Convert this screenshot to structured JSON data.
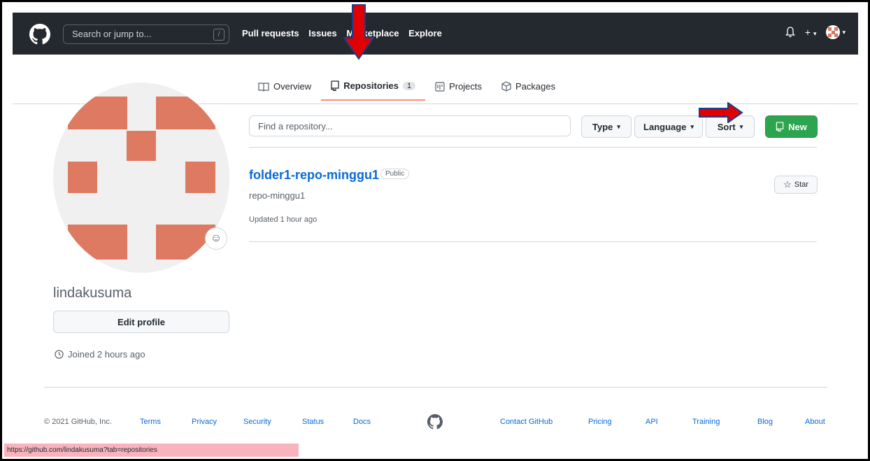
{
  "header": {
    "search_placeholder": "Search or jump to...",
    "search_shortcut": "/",
    "nav": [
      "Pull requests",
      "Issues",
      "Marketplace",
      "Explore"
    ],
    "icons": [
      "bell-icon",
      "plus-icon",
      "avatar"
    ]
  },
  "tabs": [
    {
      "label": "Overview",
      "icon": "book-icon"
    },
    {
      "label": "Repositories",
      "icon": "repo-icon",
      "count": "1",
      "active": true
    },
    {
      "label": "Projects",
      "icon": "project-icon"
    },
    {
      "label": "Packages",
      "icon": "package-icon"
    }
  ],
  "profile": {
    "username": "lindakusuma",
    "edit_label": "Edit profile",
    "joined": "Joined 2 hours ago"
  },
  "filters": {
    "find_placeholder": "Find a repository...",
    "type_label": "Type",
    "language_label": "Language",
    "sort_label": "Sort",
    "new_label": "New"
  },
  "repo": {
    "name": "folder1-repo-minggu1",
    "visibility": "Public",
    "description": "repo-minggu1",
    "updated": "Updated 1 hour ago",
    "star_label": "Star"
  },
  "footer": {
    "copyright": "© 2021 GitHub, Inc.",
    "links": [
      "Terms",
      "Privacy",
      "Security",
      "Status",
      "Docs",
      "Contact GitHub",
      "Pricing",
      "API",
      "Training",
      "Blog",
      "About"
    ]
  },
  "status_url": "https://github.com/lindakusuma?tab=repositories",
  "colors": {
    "header_bg": "#24292f",
    "accent_blue": "#0969da",
    "new_button": "#2da44e",
    "avatar_block": "#de7a62",
    "annotation_arrow": "#e00000"
  }
}
